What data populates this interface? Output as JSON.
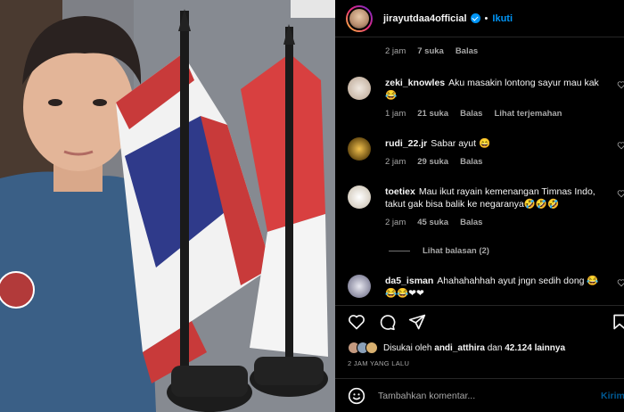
{
  "header": {
    "username": "jirayutdaa4official",
    "separator": "•",
    "follow_label": "Ikuti"
  },
  "comments": [
    {
      "user": "",
      "text": "",
      "time": "2 jam",
      "likes": "7 suka",
      "reply": "Balas"
    },
    {
      "user": "zeki_knowles",
      "text": "Aku masakin lontong sayur mau kak😂",
      "time": "1 jam",
      "likes": "21 suka",
      "reply": "Balas",
      "translate": "Lihat terjemahan"
    },
    {
      "user": "rudi_22.jr",
      "text": "Sabar ayut 😄",
      "time": "2 jam",
      "likes": "29 suka",
      "reply": "Balas"
    },
    {
      "user": "toetiex",
      "text": "Mau ikut rayain kemenangan Timnas Indo, takut gak bisa balik ke negaranya🤣🤣🤣",
      "time": "2 jam",
      "likes": "45 suka",
      "reply": "Balas"
    },
    {
      "user": "da5_isman",
      "text": "Ahahahahhah ayut jngn sedih dong 😂😂😂❤❤"
    }
  ],
  "view_replies": "Lihat balasan (2)",
  "likes": {
    "prefix": "Disukai oleh",
    "user": "andi_atthira",
    "conj": "dan",
    "count": "42.124 lainnya"
  },
  "time_ago": "2 JAM YANG LALU",
  "add_comment": {
    "placeholder": "Tambahkan komentar...",
    "post_label": "Kirim"
  },
  "icons": {
    "like": "heart-icon",
    "comment": "comment-icon",
    "share": "share-icon",
    "save": "bookmark-icon",
    "emoji": "emoji-icon",
    "verified": "verified-badge-icon"
  },
  "colors": {
    "accent": "#0095f6",
    "muted": "#a8a8a8",
    "background": "#000000"
  }
}
